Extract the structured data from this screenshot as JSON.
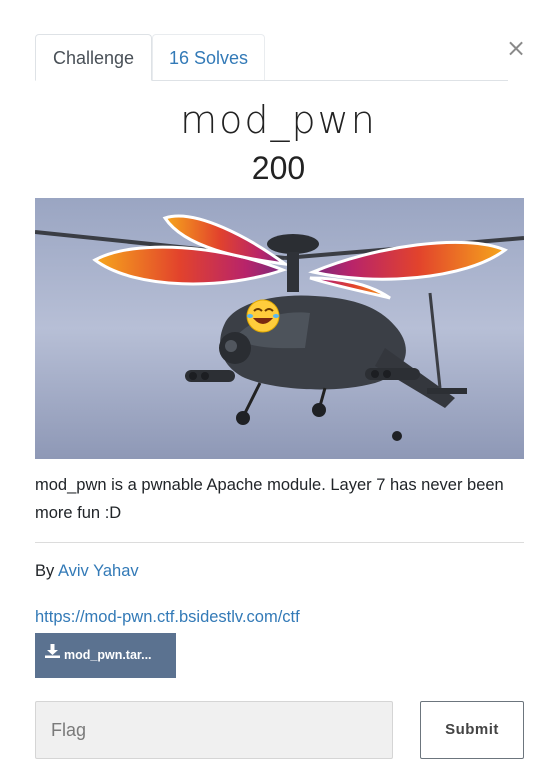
{
  "tabs": {
    "challenge": "Challenge",
    "solves": "16 Solves"
  },
  "close_label": "×",
  "challenge": {
    "name": "mod_pwn",
    "value": "200",
    "description": "mod_pwn is a pwnable Apache module. Layer 7 has never been more fun :D",
    "author_prefix": "By ",
    "author": "Aviv Yahav",
    "connection_url": "https://mod-pwn.ctf.bsidestlv.com/ctf",
    "file_label": "mod_pwn.tar..."
  },
  "form": {
    "flag_placeholder": "Flag",
    "flag_value": "",
    "submit_label": "Submit"
  },
  "icons": {
    "close": "close-icon",
    "download": "download-icon"
  },
  "colors": {
    "link": "#337ab7",
    "download_button": "#5b7290",
    "input_bg": "#f0f0f0"
  }
}
